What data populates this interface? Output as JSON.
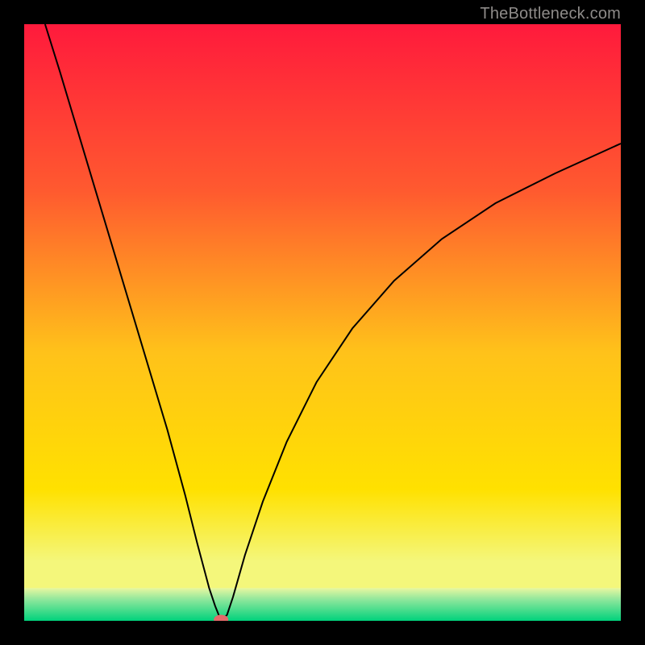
{
  "watermark": "TheBottleneck.com",
  "chart_data": {
    "type": "line",
    "title": "",
    "xlabel": "",
    "ylabel": "",
    "xlim": [
      0,
      1
    ],
    "ylim": [
      0,
      1
    ],
    "background_gradient": {
      "top_color": "#ff1a3c",
      "mid_color": "#ffe100",
      "bottom_color": "#00d27c",
      "green_band_top_y": 0.055
    },
    "series": [
      {
        "name": "bottleneck-curve",
        "color": "#000000",
        "stroke_width": 2,
        "x": [
          0.035,
          0.06,
          0.09,
          0.12,
          0.15,
          0.18,
          0.21,
          0.24,
          0.27,
          0.29,
          0.31,
          0.32,
          0.33,
          0.34,
          0.35,
          0.37,
          0.4,
          0.44,
          0.49,
          0.55,
          0.62,
          0.7,
          0.79,
          0.89,
          1.0
        ],
        "y": [
          1.0,
          0.92,
          0.82,
          0.72,
          0.62,
          0.52,
          0.42,
          0.32,
          0.21,
          0.13,
          0.055,
          0.025,
          0.0,
          0.01,
          0.04,
          0.11,
          0.2,
          0.3,
          0.4,
          0.49,
          0.57,
          0.64,
          0.7,
          0.75,
          0.8
        ]
      }
    ],
    "marker": {
      "name": "bottleneck-point",
      "x": 0.33,
      "y": 0.002,
      "color": "#e46a6a",
      "rx": 9,
      "ry": 6
    }
  }
}
